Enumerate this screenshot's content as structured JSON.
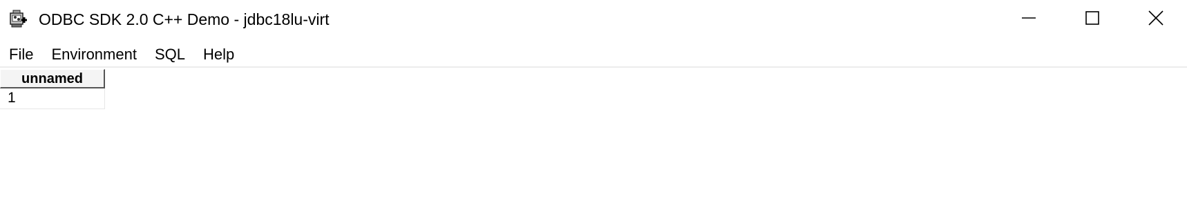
{
  "window": {
    "title": "ODBC SDK 2.0 C++ Demo - jdbc18lu-virt",
    "app_icon": "odbc-app-icon",
    "controls": {
      "minimize_icon": "minimize-icon",
      "maximize_icon": "maximize-icon",
      "close_icon": "close-icon"
    }
  },
  "menu": {
    "items": [
      {
        "label": "File"
      },
      {
        "label": "Environment"
      },
      {
        "label": "SQL"
      },
      {
        "label": "Help"
      }
    ]
  },
  "results": {
    "columns": [
      "unnamed"
    ],
    "rows": [
      [
        "1"
      ]
    ]
  }
}
